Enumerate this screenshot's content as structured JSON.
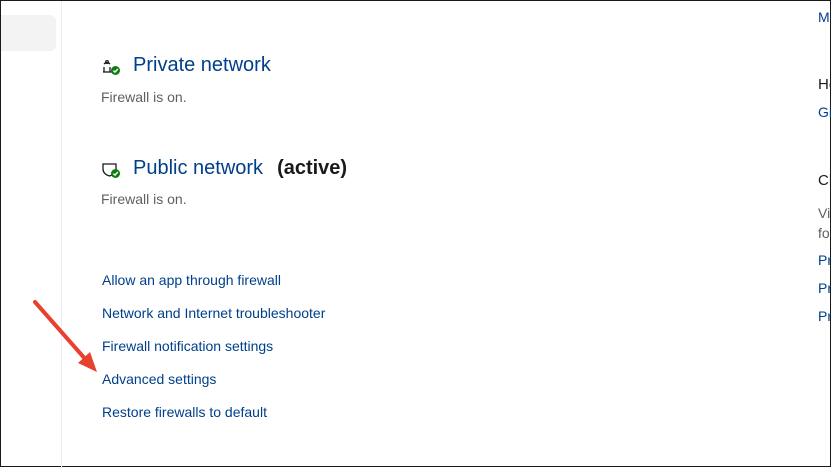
{
  "sections": {
    "private": {
      "title": "Private network",
      "status": "Firewall is on."
    },
    "public": {
      "title": "Public network",
      "active_label": "(active)",
      "status": "Firewall is on."
    }
  },
  "links": [
    "Allow an app through firewall",
    "Network and Internet troubleshooter",
    "Firewall notification settings",
    "Advanced settings",
    "Restore firewalls to default"
  ],
  "right_column": {
    "top_link": "M",
    "help_heading": "He",
    "help_link": "Gi",
    "change_heading": "Ch",
    "change_text_1": "Vi",
    "change_text_2": "fo",
    "links": [
      "Pr",
      "Pr",
      "Pr"
    ]
  },
  "colors": {
    "link": "#003f8a",
    "annotation_arrow": "#e8412e",
    "status_check": "#107c10"
  }
}
